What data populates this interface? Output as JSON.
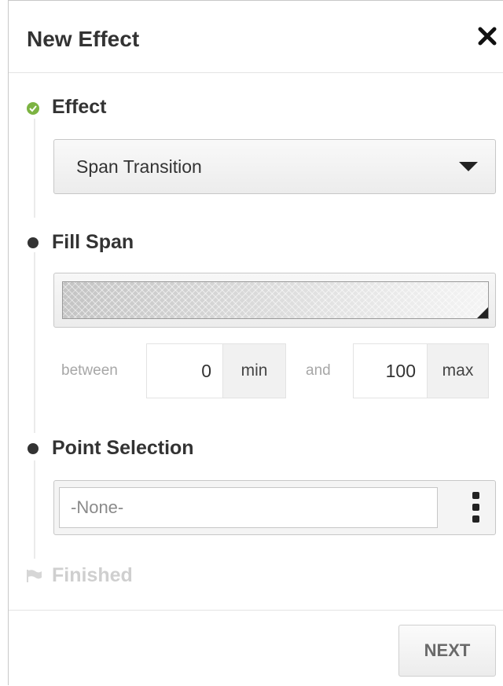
{
  "dialog": {
    "title": "New Effect",
    "close_icon": "close-icon"
  },
  "steps": {
    "effect": {
      "label": "Effect",
      "status": "complete",
      "select_value": "Span Transition"
    },
    "fill_span": {
      "label": "Fill Span",
      "status": "active",
      "between_label": "between",
      "min_value": "0",
      "min_unit": "min",
      "and_label": "and",
      "max_value": "100",
      "max_unit": "max"
    },
    "point_selection": {
      "label": "Point Selection",
      "status": "active",
      "placeholder": "-None-",
      "more_icon": "vertical-dots-icon"
    },
    "finished": {
      "label": "Finished",
      "status": "disabled",
      "icon": "flag-icon"
    }
  },
  "footer": {
    "next_label": "NEXT"
  },
  "colors": {
    "complete": "#7cb342",
    "active_dot": "#333333",
    "disabled_text": "#cfcfcf"
  }
}
